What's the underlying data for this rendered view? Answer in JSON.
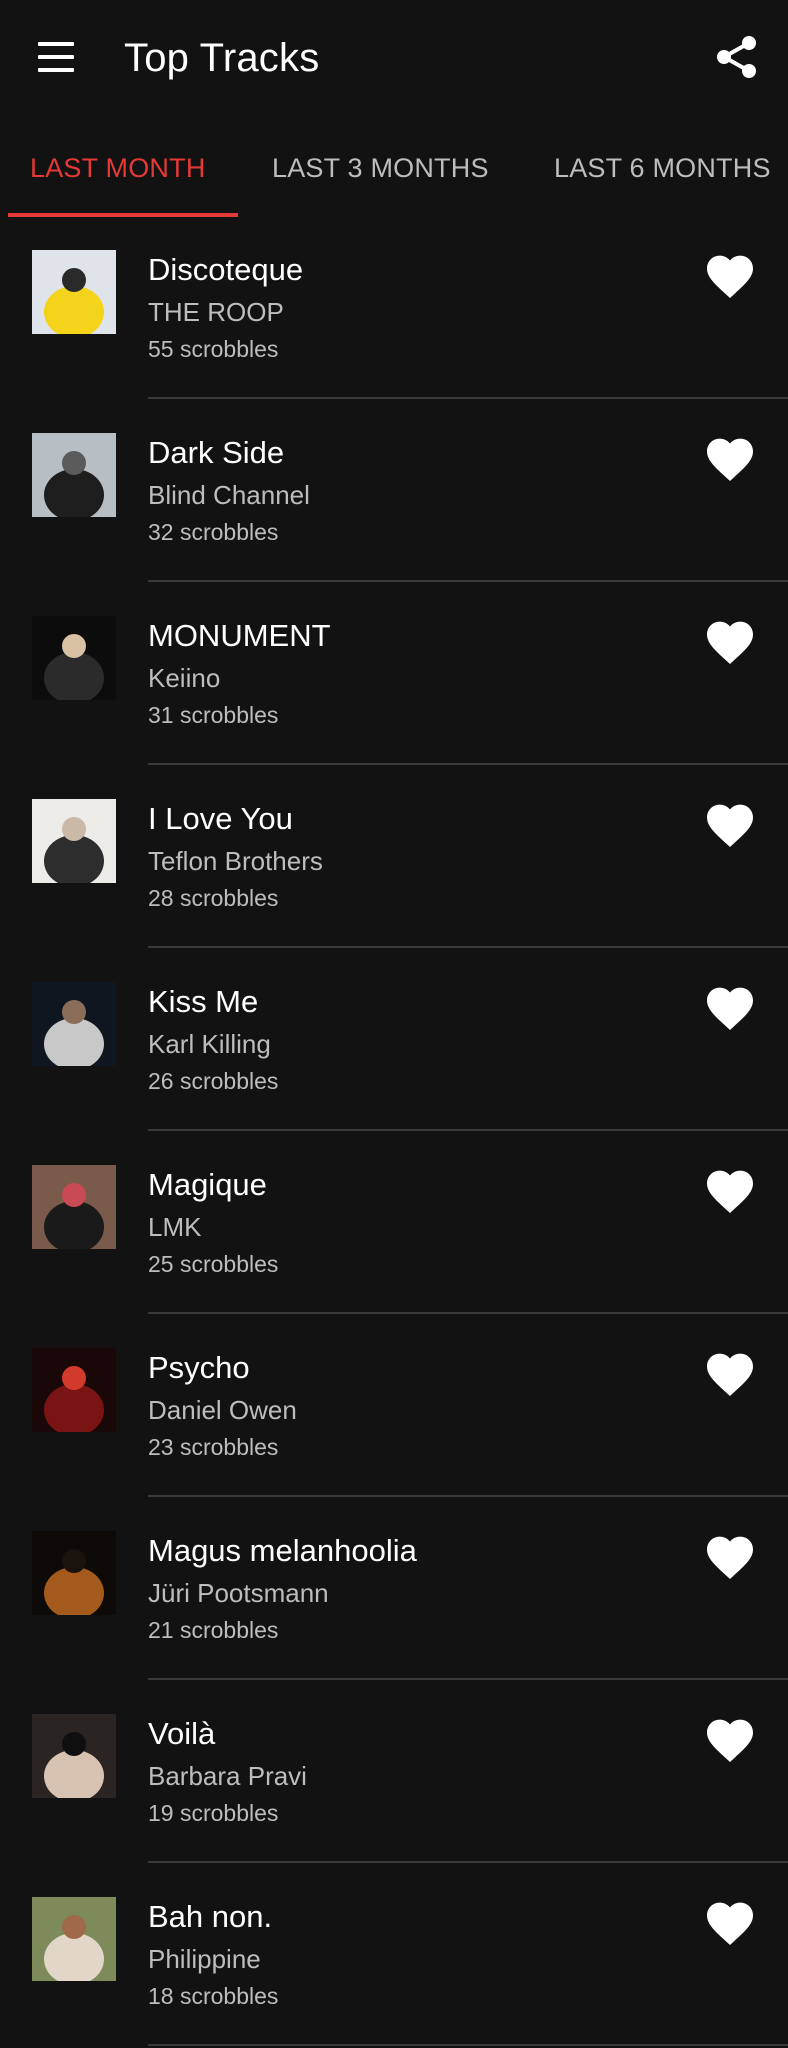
{
  "header": {
    "title": "Top Tracks",
    "menu_icon": "hamburger-menu-icon",
    "share_icon": "share-icon"
  },
  "tabs": [
    {
      "label": "LAST MONTH",
      "active": true
    },
    {
      "label": "LAST 3 MONTHS",
      "active": false
    },
    {
      "label": "LAST 6 MONTHS",
      "active": false
    }
  ],
  "colors": {
    "background": "#121212",
    "accent": "#e53935",
    "primary_text": "#ffffff",
    "secondary_text": "#bdbdbd",
    "divider": "#3a3a3a"
  },
  "tracks": [
    {
      "title": "Discoteque",
      "artist": "THE ROOP",
      "scrobbles": "55 scrobbles",
      "art": [
        "#dfe3ea",
        "#f4d31b",
        "#2a2a2a"
      ]
    },
    {
      "title": "Dark Side",
      "artist": "Blind Channel",
      "scrobbles": "32 scrobbles",
      "art": [
        "#b8bfc4",
        "#1e1e1e",
        "#5a5a5a"
      ]
    },
    {
      "title": "MONUMENT",
      "artist": "Keiino",
      "scrobbles": "31 scrobbles",
      "art": [
        "#0c0c0c",
        "#2b2b2b",
        "#d9c2a3"
      ]
    },
    {
      "title": "I Love You",
      "artist": "Teflon Brothers",
      "scrobbles": "28 scrobbles",
      "art": [
        "#ecebe8",
        "#2d2d2d",
        "#c9b9a6"
      ]
    },
    {
      "title": "Kiss Me",
      "artist": "Karl Killing",
      "scrobbles": "26 scrobbles",
      "art": [
        "#10161f",
        "#c8c8c8",
        "#8a6e5a"
      ]
    },
    {
      "title": "Magique",
      "artist": "LMK",
      "scrobbles": "25 scrobbles",
      "art": [
        "#7a5a4a",
        "#1a1a1a",
        "#c94a55"
      ]
    },
    {
      "title": "Psycho",
      "artist": "Daniel Owen",
      "scrobbles": "23 scrobbles",
      "art": [
        "#1a0708",
        "#7a1414",
        "#d23a2c"
      ]
    },
    {
      "title": "Magus melanhoolia",
      "artist": "Jüri Pootsmann",
      "scrobbles": "21 scrobbles",
      "art": [
        "#0d0a08",
        "#a35a1c",
        "#1a120c"
      ]
    },
    {
      "title": "Voilà",
      "artist": "Barbara Pravi",
      "scrobbles": "19 scrobbles",
      "art": [
        "#2a2522",
        "#d8c3b3",
        "#0f0f0f"
      ]
    },
    {
      "title": "Bah non.",
      "artist": "Philippine",
      "scrobbles": "18 scrobbles",
      "art": [
        "#7d8a5a",
        "#e2d6c8",
        "#a06a4a"
      ]
    }
  ]
}
